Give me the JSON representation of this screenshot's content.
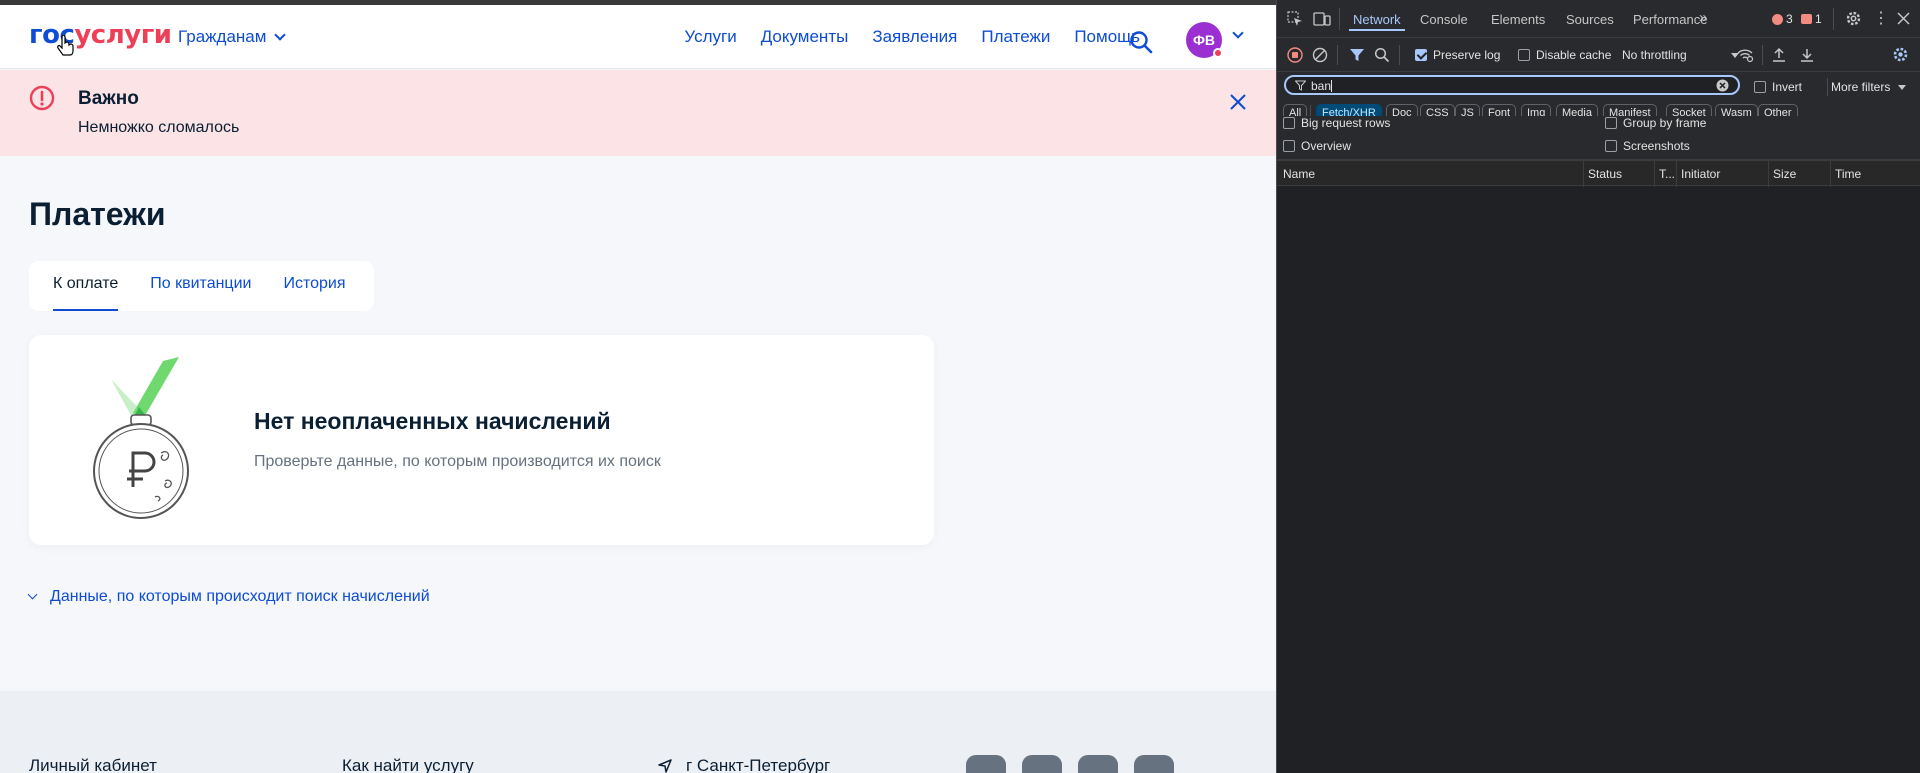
{
  "site": {
    "logo_part1": "гос",
    "logo_part2": "услуги",
    "nav_citizens": "Гражданам",
    "main_nav": [
      "Услуги",
      "Документы",
      "Заявления",
      "Платежи",
      "Помощь"
    ],
    "avatar_initials": "ФВ"
  },
  "alert": {
    "title": "Важно",
    "text": "Немножко сломалось"
  },
  "page": {
    "title": "Платежи",
    "tabs": [
      {
        "label": "К оплате",
        "active": true
      },
      {
        "label": "По квитанции",
        "active": false
      },
      {
        "label": "История",
        "active": false
      }
    ],
    "empty_title": "Нет неоплаченных начислений",
    "empty_text": "Проверьте данные, по которым производится их поиск",
    "data_link": "Данные, по которым происходит поиск начислений"
  },
  "footer": {
    "items": [
      "Личный кабинет",
      "Как найти услугу",
      "г Санкт-Петербург"
    ]
  },
  "devtools": {
    "tabs": [
      {
        "label": "Network",
        "active": true
      },
      {
        "label": "Console",
        "active": false
      },
      {
        "label": "Elements",
        "active": false
      },
      {
        "label": "Sources",
        "active": false
      },
      {
        "label": "Performance",
        "active": false
      }
    ],
    "errors_count": "3",
    "issues_count": "1",
    "toolbar": {
      "preserve_log": "Preserve log",
      "disable_cache": "Disable cache",
      "throttling": "No throttling"
    },
    "filter": {
      "value": "ban",
      "invert": "Invert",
      "more_filters": "More filters"
    },
    "types": [
      {
        "label": "All",
        "active": false
      },
      {
        "label": "Fetch/XHR",
        "active": true
      },
      {
        "label": "Doc",
        "active": false
      },
      {
        "label": "CSS",
        "active": false
      },
      {
        "label": "JS",
        "active": false
      },
      {
        "label": "Font",
        "active": false
      },
      {
        "label": "Img",
        "active": false
      },
      {
        "label": "Media",
        "active": false
      },
      {
        "label": "Manifest",
        "active": false
      },
      {
        "label": "Socket",
        "active": false
      },
      {
        "label": "Wasm",
        "active": false
      },
      {
        "label": "Other",
        "active": false
      }
    ],
    "options": {
      "big_request_rows": "Big request rows",
      "group_by_frame": "Group by frame",
      "overview": "Overview",
      "screenshots": "Screenshots"
    },
    "columns": [
      "Name",
      "Status",
      "T...",
      "Initiator",
      "Size",
      "Time"
    ]
  },
  "colors": {
    "brand_blue": "#0d4cd3",
    "brand_red": "#ee3f58",
    "alert_bg": "#fbe3e6",
    "devtools_accent": "#a8c7fa"
  }
}
